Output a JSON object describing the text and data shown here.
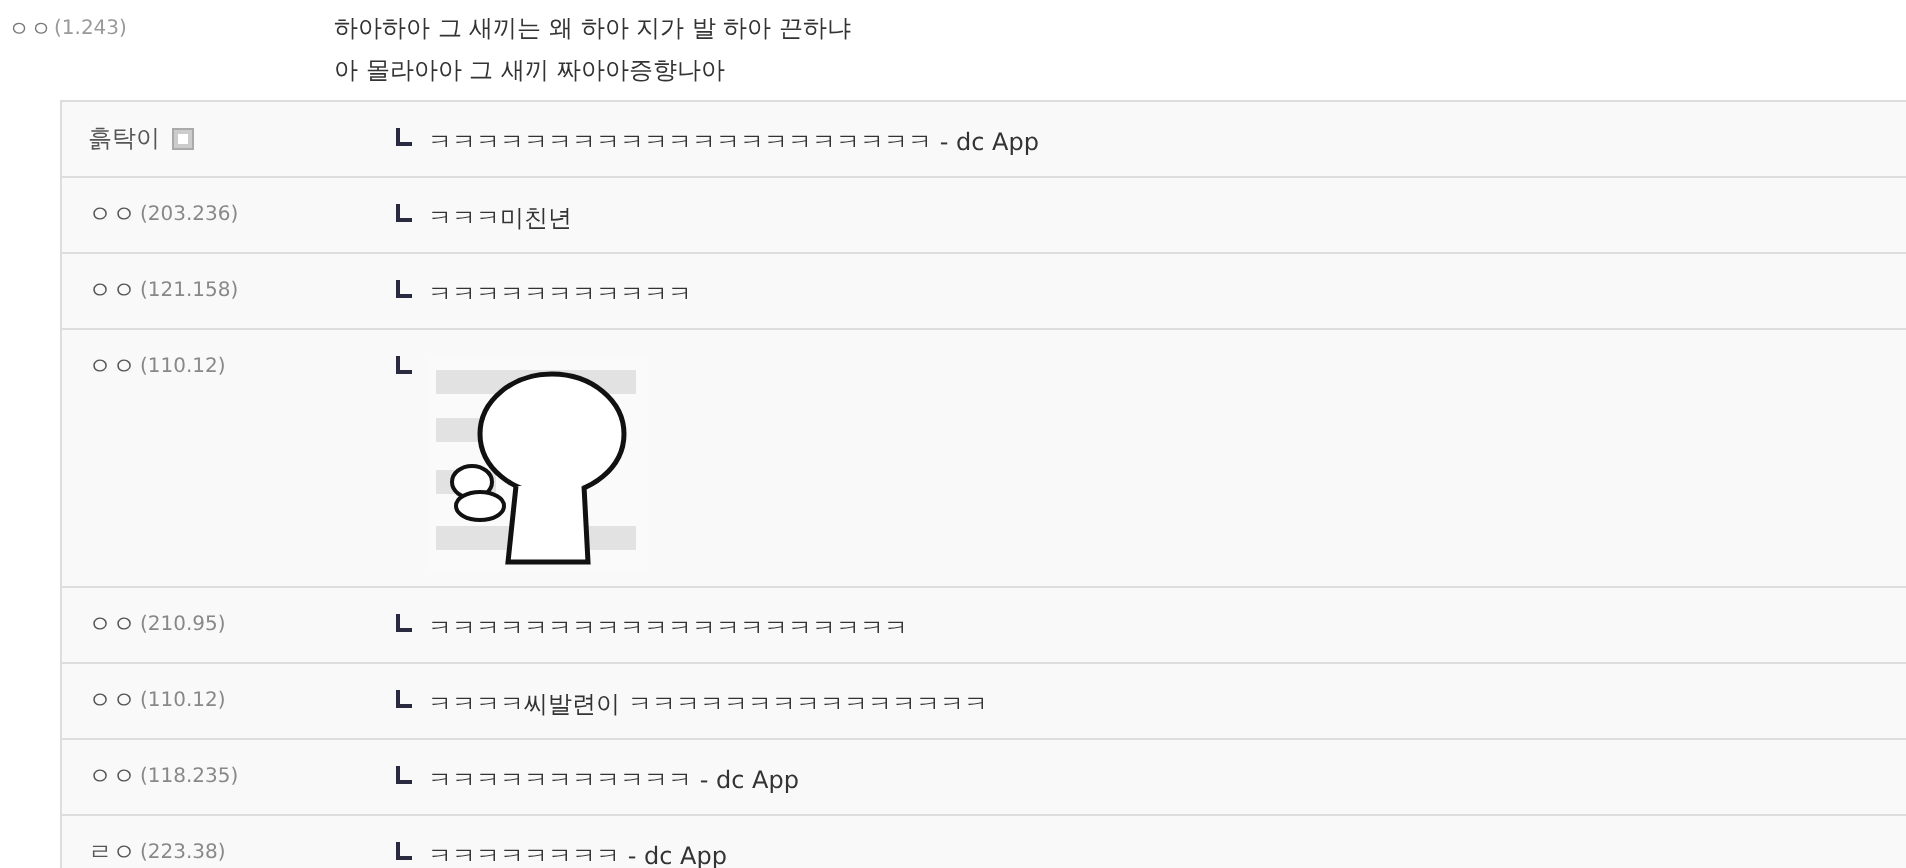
{
  "comment": {
    "author": "ㅇㅇ",
    "ip": "(1.243)",
    "lines": [
      "하아하아 그 새끼는 왜 하아 지가 발 하아 끈하냐",
      "아 몰라아아 그 새끼 짜아아증향나아"
    ]
  },
  "replies": [
    {
      "author": "흙탁이",
      "fixed_nick": true,
      "kind": "text",
      "text": "ㅋㅋㅋㅋㅋㅋㅋㅋㅋㅋㅋㅋㅋㅋㅋㅋㅋㅋㅋㅋㅋ - dc App"
    },
    {
      "author": "ㅇㅇ",
      "ip": "(203.236)",
      "fixed_nick": false,
      "kind": "text",
      "text": "ㅋㅋㅋ미친년"
    },
    {
      "author": "ㅇㅇ",
      "ip": "(121.158)",
      "fixed_nick": false,
      "kind": "text",
      "text": "ㅋㅋㅋㅋㅋㅋㅋㅋㅋㅋㅋ"
    },
    {
      "author": "ㅇㅇ",
      "ip": "(110.12)",
      "fixed_nick": false,
      "kind": "picture"
    },
    {
      "author": "ㅇㅇ",
      "ip": "(210.95)",
      "fixed_nick": false,
      "kind": "text",
      "text": "ㅋㅋㅋㅋㅋㅋㅋㅋㅋㅋㅋㅋㅋㅋㅋㅋㅋㅋㅋㅋ"
    },
    {
      "author": "ㅇㅇ",
      "ip": "(110.12)",
      "fixed_nick": false,
      "kind": "text",
      "text": "ㅋㅋㅋㅋ씨발련이 ㅋㅋㅋㅋㅋㅋㅋㅋㅋㅋㅋㅋㅋㅋㅋ"
    },
    {
      "author": "ㅇㅇ",
      "ip": "(118.235)",
      "fixed_nick": false,
      "kind": "text",
      "text": "ㅋㅋㅋㅋㅋㅋㅋㅋㅋㅋㅋ - dc App"
    },
    {
      "author": "ㄹㅇ",
      "ip": "(223.38)",
      "fixed_nick": false,
      "kind": "text",
      "text": "ㅋㅋㅋㅋㅋㅋㅋㅋ - dc App"
    }
  ]
}
